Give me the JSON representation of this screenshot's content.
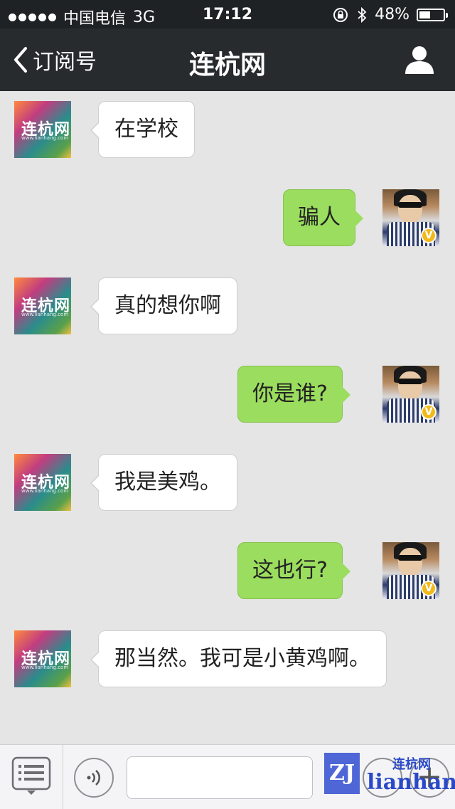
{
  "status_bar": {
    "carrier": "中国电信",
    "network": "3G",
    "time": "17:12",
    "battery": "48%",
    "battery_level": 0.48
  },
  "nav": {
    "back_label": "订阅号",
    "title": "连杭网"
  },
  "account_avatar": {
    "logo_text": "连杭网",
    "logo_url": "www.lianhang.com"
  },
  "user_avatar": {
    "badge": "V"
  },
  "messages": [
    {
      "side": "left",
      "text": "在学校"
    },
    {
      "side": "right",
      "text": "骗人"
    },
    {
      "side": "left",
      "text": "真的想你啊"
    },
    {
      "side": "right",
      "text": "你是谁?"
    },
    {
      "side": "left",
      "text": "我是美鸡。"
    },
    {
      "side": "right",
      "text": "这也行?"
    },
    {
      "side": "left",
      "text": "那当然。我可是小黄鸡啊。"
    }
  ],
  "watermark": {
    "box": "ZJ",
    "cn": "连杭网",
    "en": "lianhang"
  },
  "colors": {
    "nav_bg": "#272b2e",
    "chat_bg": "#e5e5e5",
    "outgoing_bubble": "#9bdd5e",
    "incoming_bubble": "#ffffff"
  }
}
